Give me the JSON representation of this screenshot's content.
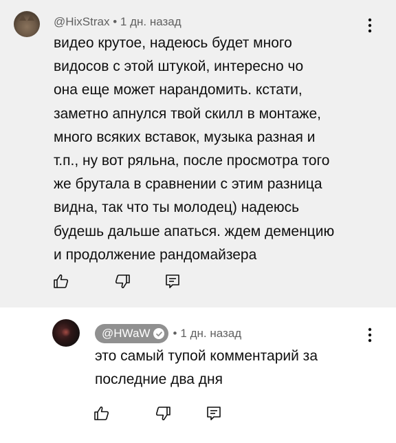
{
  "comments": [
    {
      "author": "@HixStrax",
      "separator": "•",
      "time": "1 дн. назад",
      "text": "видео крутое, надеюсь будет много\nвидосов с этой штукой, интересно чо\nона еще может нарандомить. кстати,\nзаметно апнулся твой скилл в монтаже,\nмного всяких вставок, музыка разная и\nт.п., ну вот ряльна, после просмотра того\nже брутала в сравнении с этим разница\nвидна, так что ты молодец) надеюсь\nбудешь дальше апаться. ждем деменцию\nи продолжение рандомайзера",
      "avatar_icon": "cat-avatar",
      "background": "#f0f0f0"
    },
    {
      "author": "@HWaW",
      "verified_icon": "verified-check-icon",
      "separator": "•",
      "time": "1 дн. назад",
      "text": "это самый тупой комментарий за\nпоследние два дня",
      "avatar_icon": "dark-avatar"
    }
  ],
  "action_icons": [
    "thumbs-up-icon",
    "thumbs-down-icon",
    "reply-icon"
  ],
  "menu_icon": "more-vertical-icon",
  "colors": {
    "highlight_bg": "#f0f0f0",
    "meta_text": "#606060",
    "pill_bg": "#909090"
  }
}
